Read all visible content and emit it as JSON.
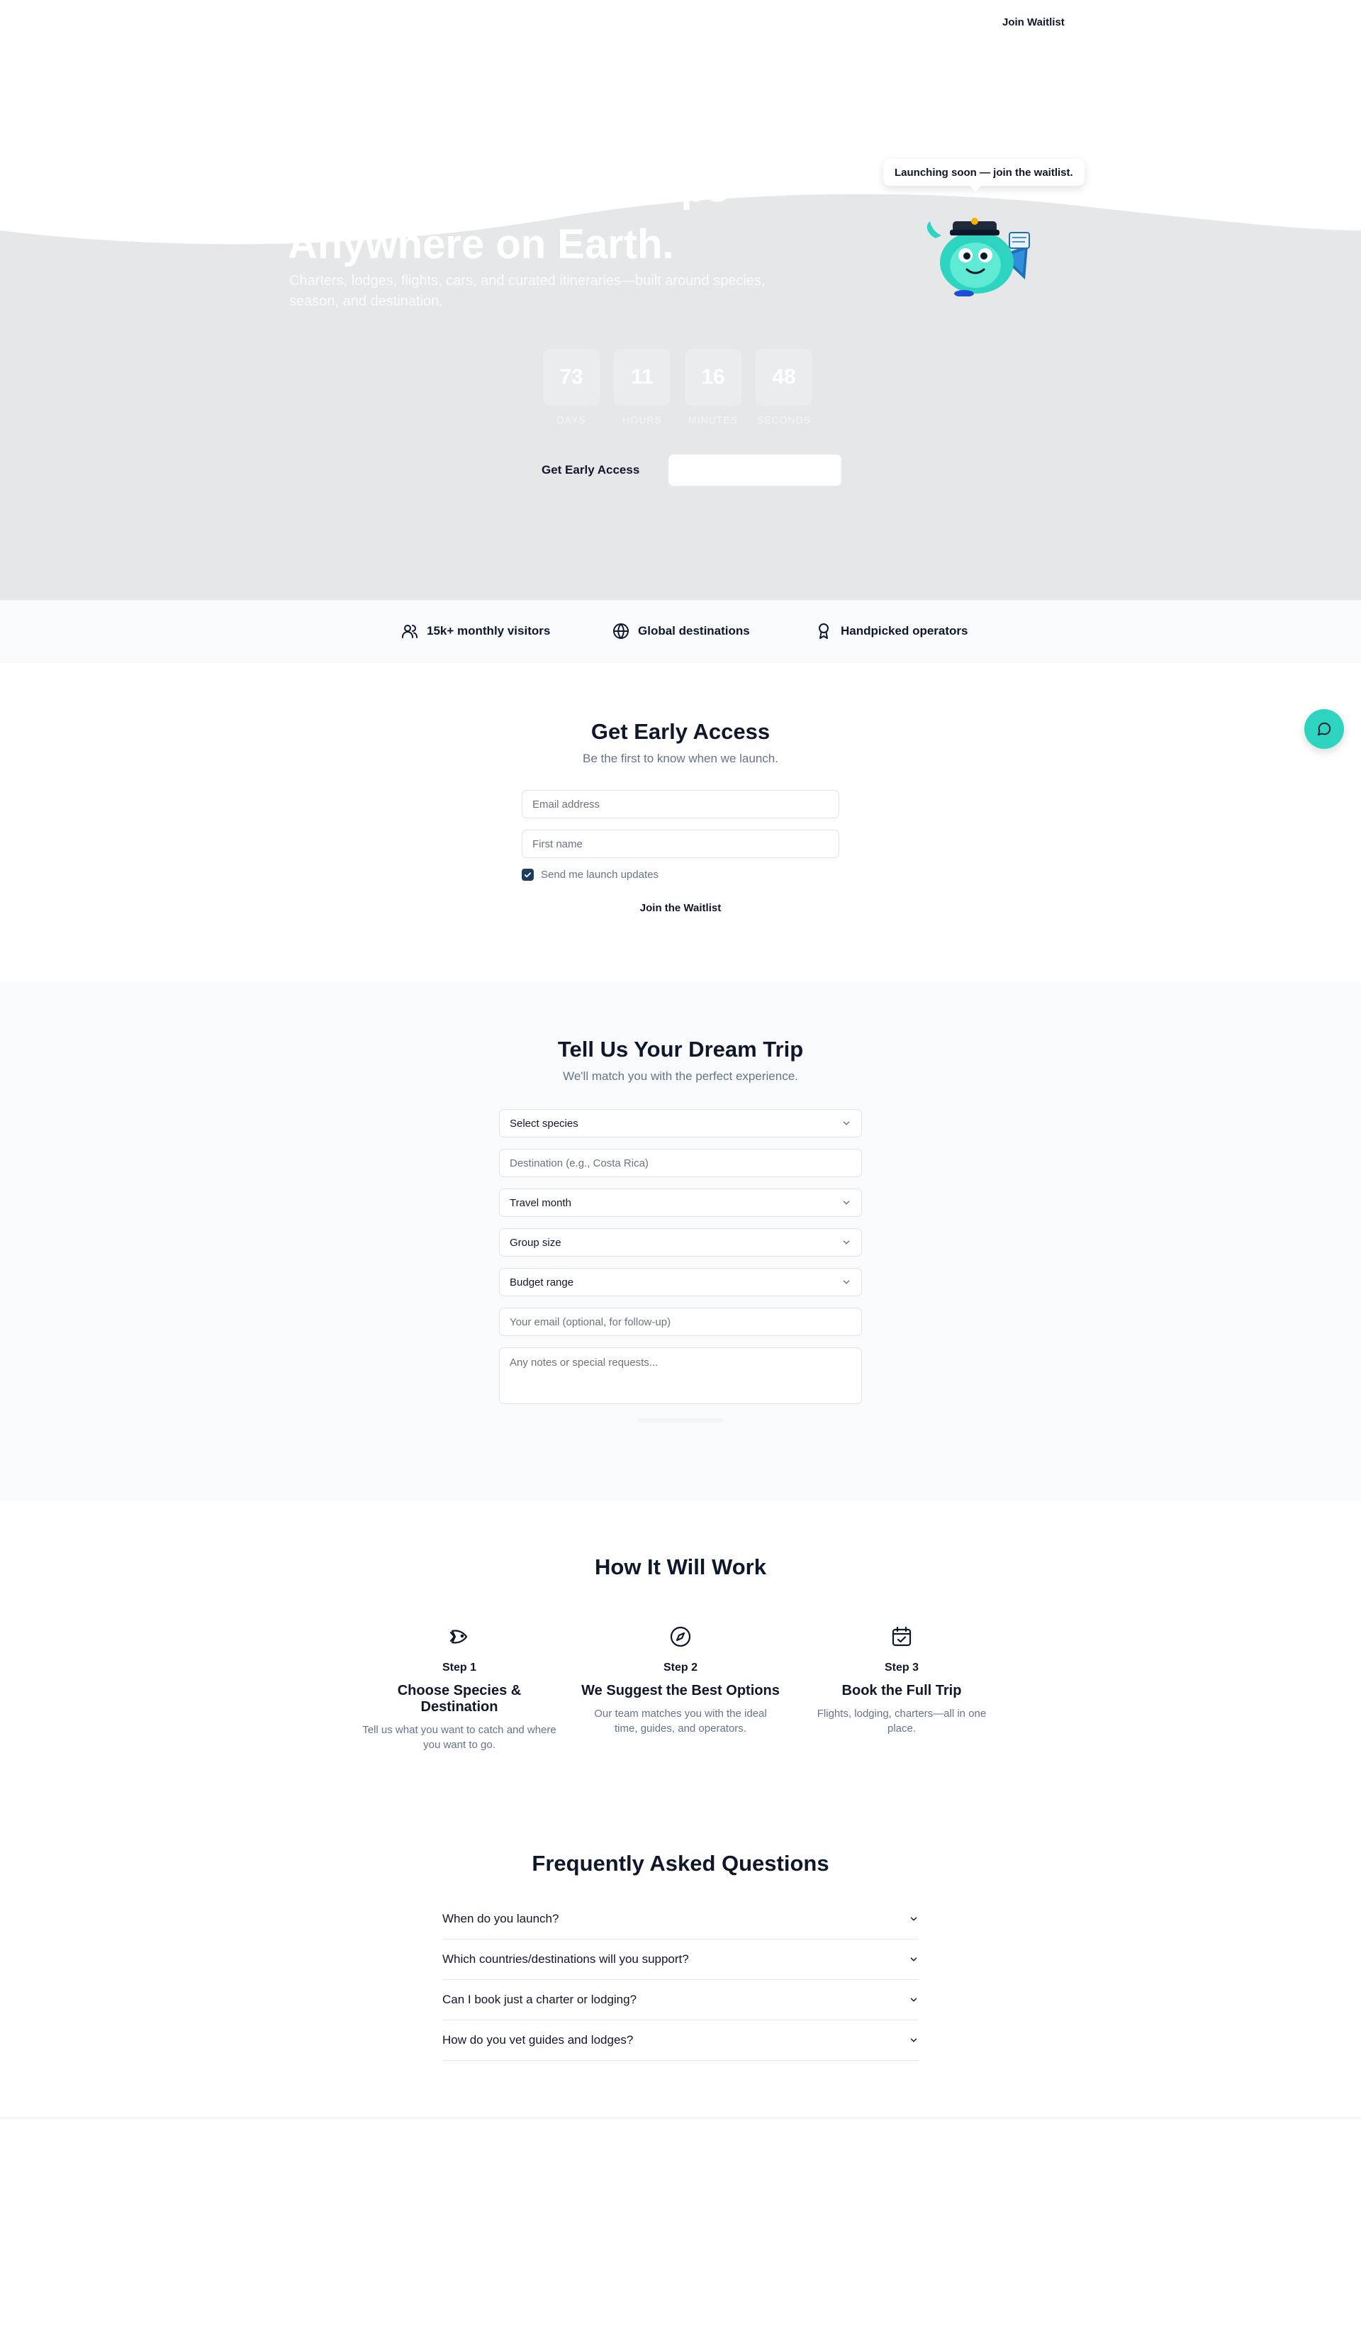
{
  "nav": {
    "join_label": "Join Waitlist"
  },
  "hero": {
    "title_line1": "The Best Fishing Trips",
    "title_line2": "Anywhere on Earth.",
    "subtitle": "Charters, lodges, flights, cars, and curated itineraries—built around species, season, and destination.",
    "countdown": [
      {
        "value": "73",
        "label": "DAYS"
      },
      {
        "value": "11",
        "label": "HOURS"
      },
      {
        "value": "16",
        "label": "MINUTES"
      },
      {
        "value": "48",
        "label": "SECONDS"
      }
    ],
    "cta_label": "Get Early Access",
    "bubble": "Launching soon — join the waitlist."
  },
  "trust": [
    {
      "icon": "users-icon",
      "label": "15k+ monthly visitors"
    },
    {
      "icon": "globe-icon",
      "label": "Global destinations"
    },
    {
      "icon": "award-icon",
      "label": "Handpicked operators"
    }
  ],
  "early": {
    "title": "Get Early Access",
    "subtitle": "Be the first to know when we launch.",
    "email_placeholder": "Email address",
    "name_placeholder": "First name",
    "checkbox_label": "Send me launch updates",
    "checkbox_checked": true,
    "submit_label": "Join the Waitlist"
  },
  "dream": {
    "title": "Tell Us Your Dream Trip",
    "subtitle": "We'll match you with the perfect experience.",
    "species": "Select species",
    "destination_placeholder": "Destination (e.g., Costa Rica)",
    "month": "Travel month",
    "group": "Group size",
    "budget": "Budget range",
    "email_placeholder": "Your email (optional, for follow-up)",
    "notes_placeholder": "Any notes or special requests..."
  },
  "how": {
    "title": "How It Will Work",
    "steps": [
      {
        "num": "Step 1",
        "title": "Choose Species & Destination",
        "desc": "Tell us what you want to catch and where you want to go.",
        "icon": "fish-icon"
      },
      {
        "num": "Step 2",
        "title": "We Suggest the Best Options",
        "desc": "Our team matches you with the ideal time, guides, and operators.",
        "icon": "compass-icon"
      },
      {
        "num": "Step 3",
        "title": "Book the Full Trip",
        "desc": "Flights, lodging, charters—all in one place.",
        "icon": "calendar-check-icon"
      }
    ]
  },
  "faq": {
    "title": "Frequently Asked Questions",
    "items": [
      "When do you launch?",
      "Which countries/destinations will you support?",
      "Can I book just a charter or lodging?",
      "How do you vet guides and lodges?"
    ]
  },
  "colors": {
    "accent": "#2dd4bf",
    "navy": "#1e3a5f",
    "hero_bg": "#e6e7e9",
    "muted": "#64748b"
  }
}
